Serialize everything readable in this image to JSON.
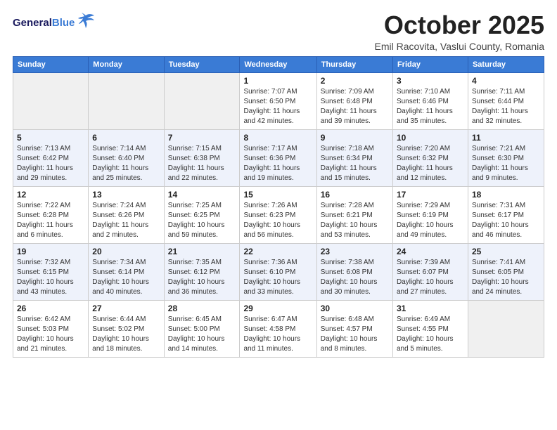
{
  "header": {
    "logo_line1": "General",
    "logo_line2": "Blue",
    "month_title": "October 2025",
    "subtitle": "Emil Racovita, Vaslui County, Romania"
  },
  "weekdays": [
    "Sunday",
    "Monday",
    "Tuesday",
    "Wednesday",
    "Thursday",
    "Friday",
    "Saturday"
  ],
  "weeks": [
    [
      {
        "day": "",
        "info": ""
      },
      {
        "day": "",
        "info": ""
      },
      {
        "day": "",
        "info": ""
      },
      {
        "day": "1",
        "info": "Sunrise: 7:07 AM\nSunset: 6:50 PM\nDaylight: 11 hours\nand 42 minutes."
      },
      {
        "day": "2",
        "info": "Sunrise: 7:09 AM\nSunset: 6:48 PM\nDaylight: 11 hours\nand 39 minutes."
      },
      {
        "day": "3",
        "info": "Sunrise: 7:10 AM\nSunset: 6:46 PM\nDaylight: 11 hours\nand 35 minutes."
      },
      {
        "day": "4",
        "info": "Sunrise: 7:11 AM\nSunset: 6:44 PM\nDaylight: 11 hours\nand 32 minutes."
      }
    ],
    [
      {
        "day": "5",
        "info": "Sunrise: 7:13 AM\nSunset: 6:42 PM\nDaylight: 11 hours\nand 29 minutes."
      },
      {
        "day": "6",
        "info": "Sunrise: 7:14 AM\nSunset: 6:40 PM\nDaylight: 11 hours\nand 25 minutes."
      },
      {
        "day": "7",
        "info": "Sunrise: 7:15 AM\nSunset: 6:38 PM\nDaylight: 11 hours\nand 22 minutes."
      },
      {
        "day": "8",
        "info": "Sunrise: 7:17 AM\nSunset: 6:36 PM\nDaylight: 11 hours\nand 19 minutes."
      },
      {
        "day": "9",
        "info": "Sunrise: 7:18 AM\nSunset: 6:34 PM\nDaylight: 11 hours\nand 15 minutes."
      },
      {
        "day": "10",
        "info": "Sunrise: 7:20 AM\nSunset: 6:32 PM\nDaylight: 11 hours\nand 12 minutes."
      },
      {
        "day": "11",
        "info": "Sunrise: 7:21 AM\nSunset: 6:30 PM\nDaylight: 11 hours\nand 9 minutes."
      }
    ],
    [
      {
        "day": "12",
        "info": "Sunrise: 7:22 AM\nSunset: 6:28 PM\nDaylight: 11 hours\nand 6 minutes."
      },
      {
        "day": "13",
        "info": "Sunrise: 7:24 AM\nSunset: 6:26 PM\nDaylight: 11 hours\nand 2 minutes."
      },
      {
        "day": "14",
        "info": "Sunrise: 7:25 AM\nSunset: 6:25 PM\nDaylight: 10 hours\nand 59 minutes."
      },
      {
        "day": "15",
        "info": "Sunrise: 7:26 AM\nSunset: 6:23 PM\nDaylight: 10 hours\nand 56 minutes."
      },
      {
        "day": "16",
        "info": "Sunrise: 7:28 AM\nSunset: 6:21 PM\nDaylight: 10 hours\nand 53 minutes."
      },
      {
        "day": "17",
        "info": "Sunrise: 7:29 AM\nSunset: 6:19 PM\nDaylight: 10 hours\nand 49 minutes."
      },
      {
        "day": "18",
        "info": "Sunrise: 7:31 AM\nSunset: 6:17 PM\nDaylight: 10 hours\nand 46 minutes."
      }
    ],
    [
      {
        "day": "19",
        "info": "Sunrise: 7:32 AM\nSunset: 6:15 PM\nDaylight: 10 hours\nand 43 minutes."
      },
      {
        "day": "20",
        "info": "Sunrise: 7:34 AM\nSunset: 6:14 PM\nDaylight: 10 hours\nand 40 minutes."
      },
      {
        "day": "21",
        "info": "Sunrise: 7:35 AM\nSunset: 6:12 PM\nDaylight: 10 hours\nand 36 minutes."
      },
      {
        "day": "22",
        "info": "Sunrise: 7:36 AM\nSunset: 6:10 PM\nDaylight: 10 hours\nand 33 minutes."
      },
      {
        "day": "23",
        "info": "Sunrise: 7:38 AM\nSunset: 6:08 PM\nDaylight: 10 hours\nand 30 minutes."
      },
      {
        "day": "24",
        "info": "Sunrise: 7:39 AM\nSunset: 6:07 PM\nDaylight: 10 hours\nand 27 minutes."
      },
      {
        "day": "25",
        "info": "Sunrise: 7:41 AM\nSunset: 6:05 PM\nDaylight: 10 hours\nand 24 minutes."
      }
    ],
    [
      {
        "day": "26",
        "info": "Sunrise: 6:42 AM\nSunset: 5:03 PM\nDaylight: 10 hours\nand 21 minutes."
      },
      {
        "day": "27",
        "info": "Sunrise: 6:44 AM\nSunset: 5:02 PM\nDaylight: 10 hours\nand 18 minutes."
      },
      {
        "day": "28",
        "info": "Sunrise: 6:45 AM\nSunset: 5:00 PM\nDaylight: 10 hours\nand 14 minutes."
      },
      {
        "day": "29",
        "info": "Sunrise: 6:47 AM\nSunset: 4:58 PM\nDaylight: 10 hours\nand 11 minutes."
      },
      {
        "day": "30",
        "info": "Sunrise: 6:48 AM\nSunset: 4:57 PM\nDaylight: 10 hours\nand 8 minutes."
      },
      {
        "day": "31",
        "info": "Sunrise: 6:49 AM\nSunset: 4:55 PM\nDaylight: 10 hours\nand 5 minutes."
      },
      {
        "day": "",
        "info": ""
      }
    ]
  ]
}
